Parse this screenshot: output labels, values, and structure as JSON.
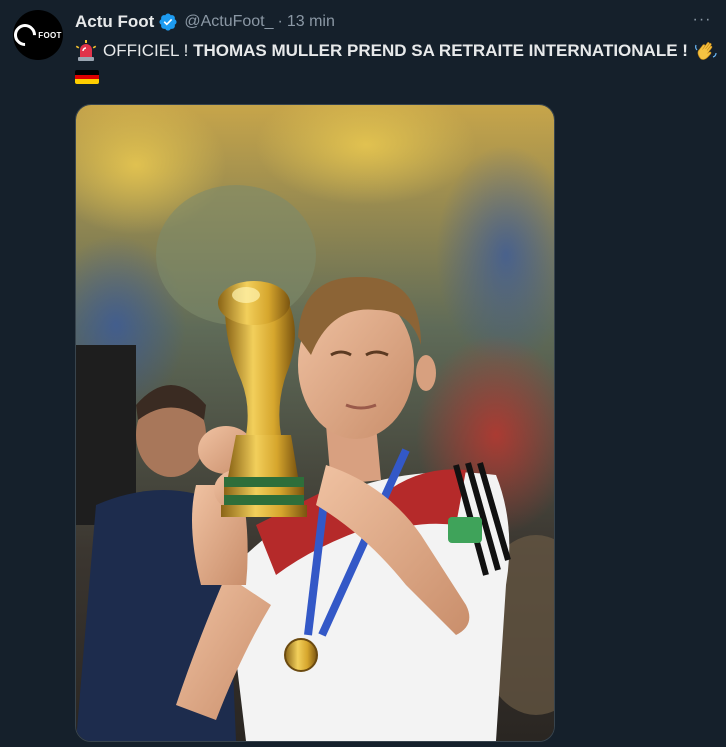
{
  "tweet": {
    "author_name": "Actu Foot",
    "handle": "@ActuFoot_",
    "separator": "·",
    "time": "13 min",
    "more_label": "···",
    "avatar_text": "FOOT",
    "text_prefix": "OFFICIEL ! ",
    "text_bold": "THOMAS MULLER PREND SA RETRAITE INTERNATIONALE !",
    "emoji_start": "siren-icon",
    "emoji_end": "waving-hand-icon",
    "emoji_flag": "germany-flag-icon"
  },
  "colors": {
    "background": "#15202b",
    "text": "#e7e9ea",
    "secondary": "#8b98a5",
    "verified": "#1d9bf0"
  }
}
